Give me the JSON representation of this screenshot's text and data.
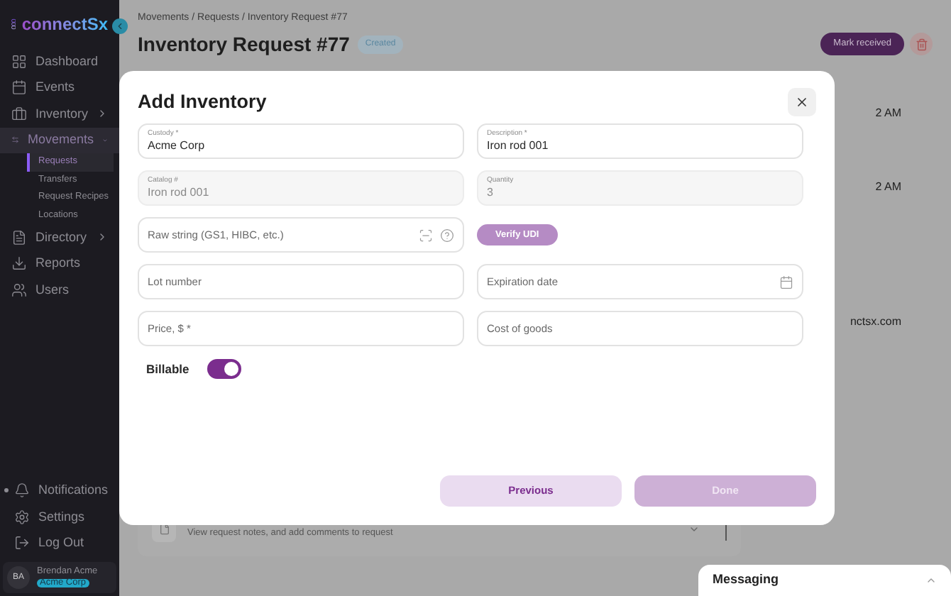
{
  "sidebar": {
    "logo": "connectSx",
    "items": [
      {
        "label": "Dashboard",
        "selected": false
      },
      {
        "label": "Events",
        "selected": false
      },
      {
        "label": "Inventory",
        "selected": false,
        "expanded": false
      },
      {
        "label": "Movements",
        "selected": true,
        "expanded": true,
        "children": [
          {
            "label": "Requests",
            "selected": true
          },
          {
            "label": "Transfers",
            "selected": false
          },
          {
            "label": "Request Recipes",
            "selected": false
          },
          {
            "label": "Locations",
            "selected": false
          }
        ]
      },
      {
        "label": "Directory",
        "selected": false,
        "expanded": false
      },
      {
        "label": "Reports",
        "selected": false
      },
      {
        "label": "Users",
        "selected": false
      }
    ],
    "bottom_items": [
      {
        "label": "Notifications",
        "unread": true
      },
      {
        "label": "Settings",
        "unread": false
      },
      {
        "label": "Log Out",
        "unread": false
      }
    ],
    "user": {
      "initials": "BA",
      "name": "Brendan Acme",
      "company": "Acme Corp"
    }
  },
  "header": {
    "breadcrumb": "Movements / Requests / Inventory Request #77",
    "title": "Inventory Request #77",
    "status": "Created",
    "action": "Mark received"
  },
  "background": {
    "times": [
      "2 AM",
      "2 AM"
    ],
    "email_fragment": "nctsx.com",
    "notes_description": "View request notes, and add comments to request"
  },
  "modal": {
    "title": "Add Inventory",
    "fields": [
      {
        "kind": "text",
        "label": "Custody *",
        "value": "Acme Corp",
        "disabled": false
      },
      {
        "kind": "text",
        "label": "Description *",
        "value": "Iron rod 001",
        "disabled": false
      },
      {
        "kind": "text",
        "label": "Catalog #",
        "value": "Iron rod 001",
        "disabled": true
      },
      {
        "kind": "text",
        "label": "Quantity",
        "value": "3",
        "disabled": true
      },
      {
        "kind": "scan",
        "placeholder": "Raw string (GS1, HIBC, etc.)",
        "disabled": false
      },
      {
        "kind": "button",
        "label": "Verify UDI",
        "disabled": true
      },
      {
        "kind": "text",
        "placeholder": "Lot number",
        "disabled": false
      },
      {
        "kind": "date",
        "placeholder": "Expiration date",
        "disabled": false
      },
      {
        "kind": "text",
        "placeholder": "Price, $ *",
        "disabled": false
      },
      {
        "kind": "text",
        "placeholder": "Cost of goods",
        "disabled": false
      }
    ],
    "billable": {
      "label": "Billable",
      "on": true
    },
    "buttons": [
      {
        "label": "Previous",
        "kind": "secondary",
        "disabled": false
      },
      {
        "label": "Done",
        "kind": "primary",
        "disabled": true
      }
    ]
  },
  "messaging": {
    "title": "Messaging"
  }
}
